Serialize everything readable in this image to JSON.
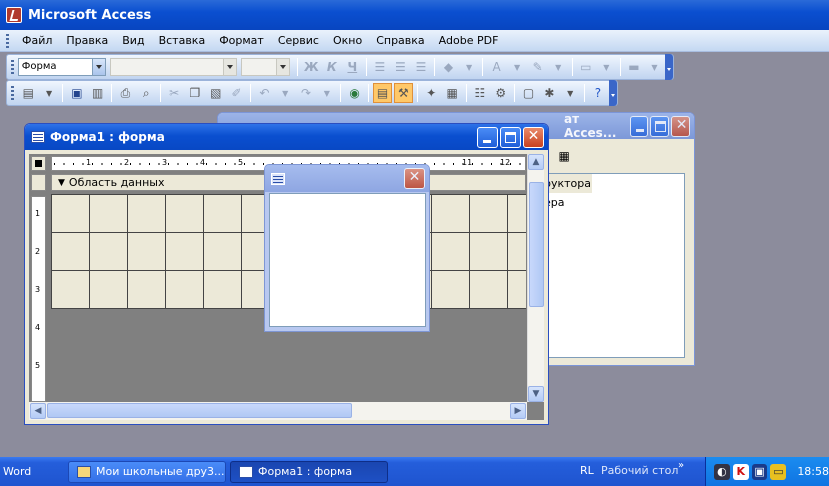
{
  "app": {
    "title": "Microsoft Access"
  },
  "menubar": {
    "items": [
      "Файл",
      "Правка",
      "Вид",
      "Вставка",
      "Формат",
      "Сервис",
      "Окно",
      "Справка",
      "Adobe PDF"
    ]
  },
  "toolbar_format": {
    "object_combo": "Форма",
    "bold": "Ж",
    "italic": "К",
    "underline": "Ч",
    "font_color_label": "A"
  },
  "db_window": {
    "title_fragment": "ат Acces...",
    "list_items": [
      "руктора",
      "ера"
    ]
  },
  "form_window": {
    "title": "Форма1 : форма",
    "section_label": "Область данных",
    "ruler_h_labels": [
      "1",
      "2",
      "3",
      "4",
      "5",
      "11",
      "12"
    ],
    "ruler_v_labels": [
      "1",
      "2",
      "3",
      "4",
      "5"
    ]
  },
  "taskbar": {
    "word_label": "Word",
    "tasks": [
      "Мои школьные дру3...",
      "Форма1 : форма"
    ],
    "language": "RL",
    "desktop_label": "Рабочий стол",
    "clock": "18:58"
  },
  "colors": {
    "title_blue": "#0a4fd0",
    "form_grid": "#ece9d8",
    "taskbar": "#245edb"
  }
}
